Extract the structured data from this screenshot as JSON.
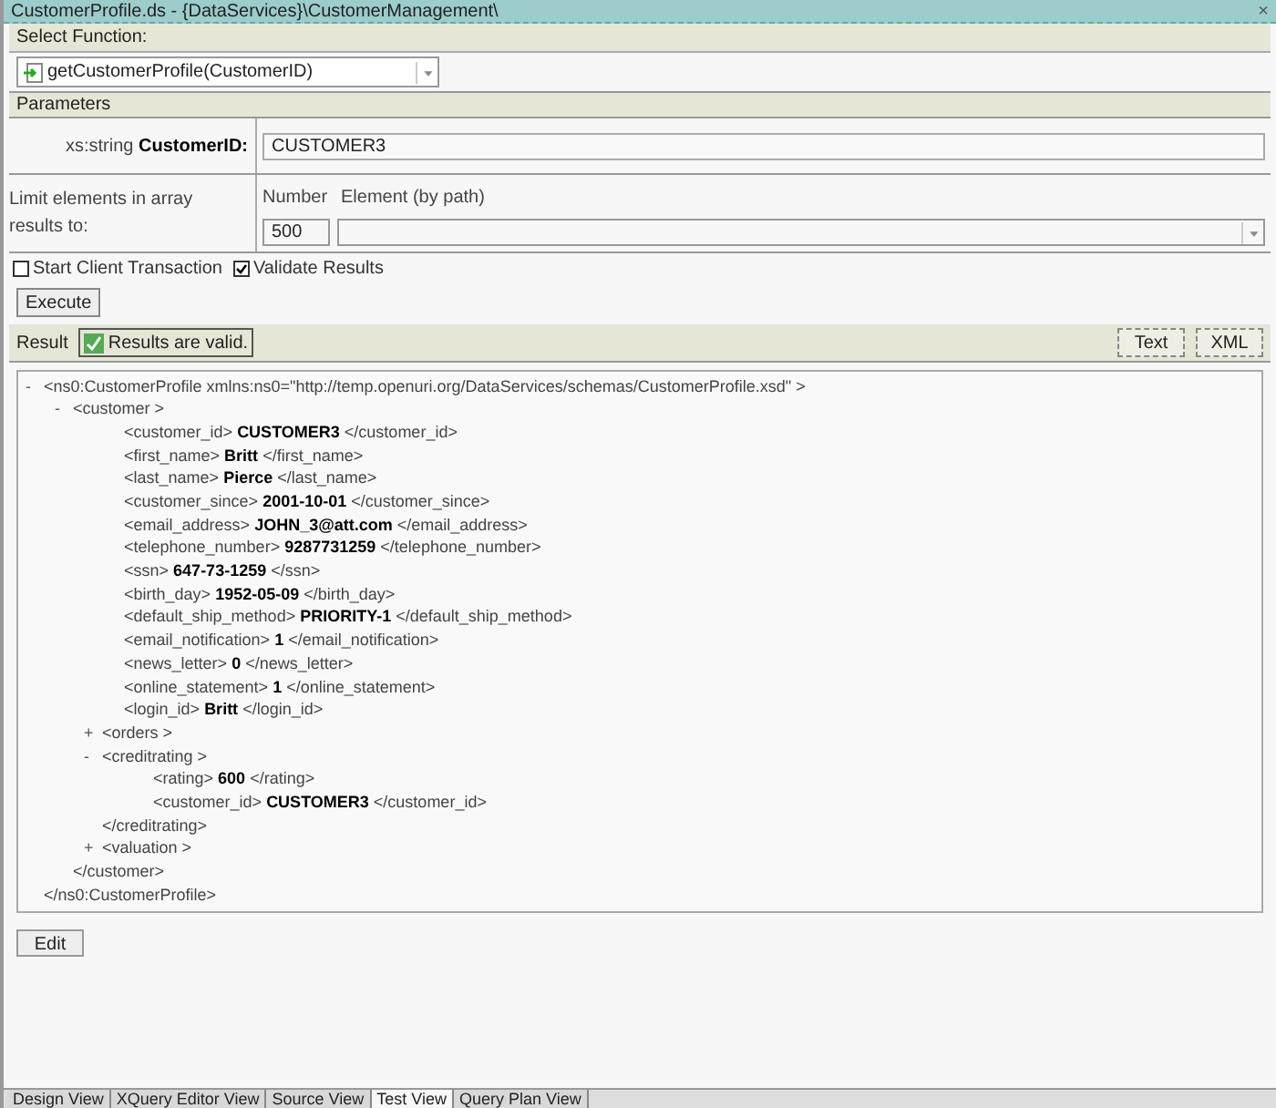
{
  "window": {
    "title": "CustomerProfile.ds - {DataServices}\\CustomerManagement\\",
    "close": "×"
  },
  "select_function": {
    "label": "Select Function:",
    "value": "getCustomerProfile(CustomerID)"
  },
  "parameters": {
    "header": "Parameters",
    "param_label_prefix": "xs:string",
    "param_label_name": "CustomerID:",
    "param_value": "CUSTOMER3",
    "limit_label": "Limit elements in array results to:",
    "number_label": "Number",
    "element_label": "Element (by path)",
    "number_value": "500"
  },
  "options": [
    {
      "label": "Start Client Transaction",
      "checked": false
    },
    {
      "label": "Validate Results",
      "checked": true
    }
  ],
  "execute_button": "Execute",
  "result": {
    "label": "Result",
    "status": "Results are valid.",
    "view_buttons": [
      {
        "label": "Text",
        "selected": false
      },
      {
        "label": "XML",
        "selected": false
      }
    ]
  },
  "tree": {
    "marker": "-",
    "open": "<ns0:CustomerProfile xmlns:ns0=\"http://temp.openuri.org/DataServices/schemas/CustomerProfile.xsd\" >",
    "close": "</ns0:CustomerProfile>",
    "children": [
      {
        "marker": "-",
        "open": "<customer >",
        "close": "</customer>",
        "children": [
          {
            "open": "<customer_id>",
            "value": "CUSTOMER3",
            "close": "</customer_id>"
          },
          {
            "open": "<first_name>",
            "value": "Britt",
            "close": "</first_name>"
          },
          {
            "open": "<last_name>",
            "value": "Pierce",
            "close": "</last_name>"
          },
          {
            "open": "<customer_since>",
            "value": "2001-10-01",
            "close": "</customer_since>"
          },
          {
            "open": "<email_address>",
            "value": "JOHN_3@att.com",
            "close": "</email_address>"
          },
          {
            "open": "<telephone_number>",
            "value": "9287731259",
            "close": "</telephone_number>"
          },
          {
            "open": "<ssn>",
            "value": "647-73-1259",
            "close": "</ssn>"
          },
          {
            "open": "<birth_day>",
            "value": "1952-05-09",
            "close": "</birth_day>"
          },
          {
            "open": "<default_ship_method>",
            "value": "PRIORITY-1",
            "close": "</default_ship_method>"
          },
          {
            "open": "<email_notification>",
            "value": "1",
            "close": "</email_notification>"
          },
          {
            "open": "<news_letter>",
            "value": "0",
            "close": "</news_letter>"
          },
          {
            "open": "<online_statement>",
            "value": "1",
            "close": "</online_statement>"
          },
          {
            "open": "<login_id>",
            "value": "Britt",
            "close": "</login_id>"
          },
          {
            "marker": "+",
            "open": "<orders >"
          },
          {
            "marker": "-",
            "open": "<creditrating >",
            "close": "</creditrating>",
            "children": [
              {
                "open": "<rating>",
                "value": "600",
                "close": "</rating>"
              },
              {
                "open": "<customer_id>",
                "value": "CUSTOMER3",
                "close": "</customer_id>"
              }
            ]
          },
          {
            "marker": "+",
            "open": "<valuation >"
          }
        ]
      }
    ]
  },
  "edit_button": "Edit",
  "view_tabs": [
    {
      "label": "Design View",
      "selected": false
    },
    {
      "label": "XQuery Editor View",
      "selected": false
    },
    {
      "label": "Source View",
      "selected": false
    },
    {
      "label": "Test View",
      "selected": true
    },
    {
      "label": "Query Plan View",
      "selected": false
    }
  ]
}
